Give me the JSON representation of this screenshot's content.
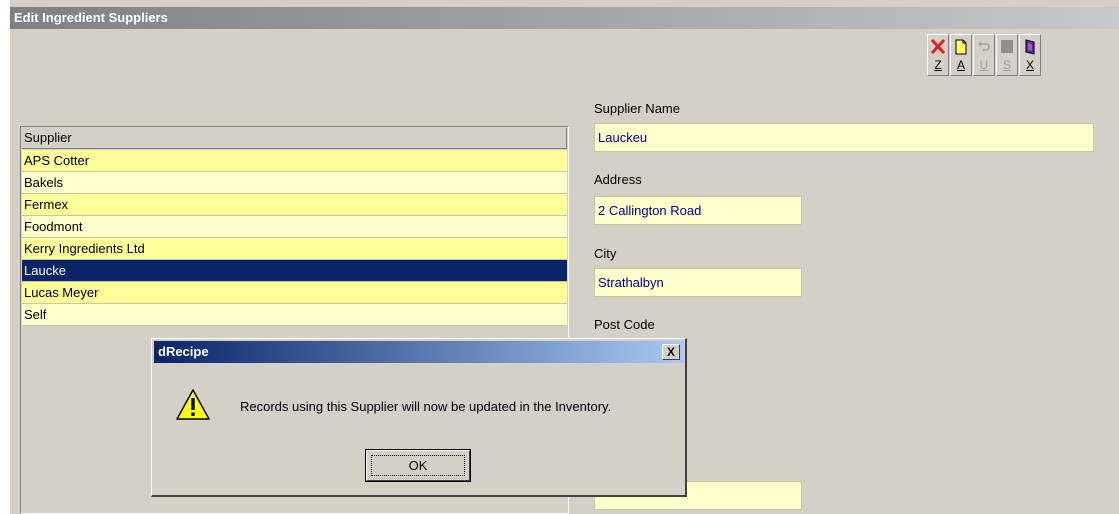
{
  "window": {
    "title": "Edit Ingredient Suppliers"
  },
  "toolbar": {
    "buttons": [
      {
        "icon": "delete-x-icon",
        "key": "Z",
        "enabled": true
      },
      {
        "icon": "add-page-icon",
        "key": "A",
        "enabled": true
      },
      {
        "icon": "undo-icon",
        "key": "U",
        "enabled": false
      },
      {
        "icon": "save-icon",
        "key": "S",
        "enabled": false
      },
      {
        "icon": "exit-door-icon",
        "key": "X",
        "enabled": true
      }
    ]
  },
  "supplier_list": {
    "header": "Supplier",
    "items": [
      "APS Cotter",
      "Bakels",
      "Fermex",
      "Foodmont",
      "Kerry Ingredients Ltd",
      "Laucke",
      "Lucas Meyer",
      "Self"
    ],
    "selected": "Laucke"
  },
  "form": {
    "supplier_name_label": "Supplier Name",
    "supplier_name": "Lauckeu",
    "address_label": "Address",
    "address": "2 Callington Road",
    "city_label": "City",
    "city": "Strathalbyn",
    "postcode_label": "Post Code",
    "bottom_field": ""
  },
  "dialog": {
    "title": "dRecipe",
    "close": "X",
    "message": "Records using this Supplier will now be updated in the Inventory.",
    "ok_label": "OK",
    "icon": "warning-icon"
  },
  "colors": {
    "row_odd": "#ffff99",
    "row_even": "#ffffcc",
    "selected": "#0a246a",
    "field_text": "#00008b"
  }
}
